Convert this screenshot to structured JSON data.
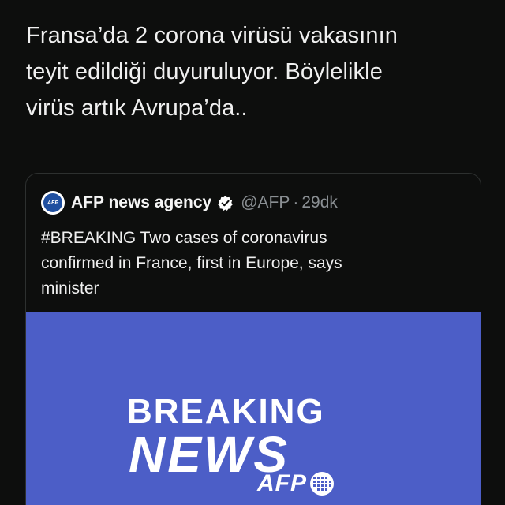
{
  "tweet": {
    "text": "Fransa’da 2 corona virüsü vakasının\nteyit edildiği duyuruluyor. Böylelikle\nvirüs artık Avrupa’da.."
  },
  "quoted": {
    "avatar_text": "AFP",
    "display_name": "AFP news agency",
    "verified_icon": "verified-badge-icon",
    "handle": "@AFP",
    "separator": "·",
    "time": "29dk",
    "text": "#BREAKING Two cases of coronavirus\nconfirmed in France, first in Europe, says\nminister",
    "media": {
      "line1": "BREAKING",
      "line2": "NEWS",
      "logo_text": "AFP",
      "background": "#4c5ec7"
    }
  },
  "colors": {
    "background": "#0d0e0d",
    "text": "#f0f0f0",
    "muted": "#8a8f93",
    "card_border": "#2d302f"
  }
}
